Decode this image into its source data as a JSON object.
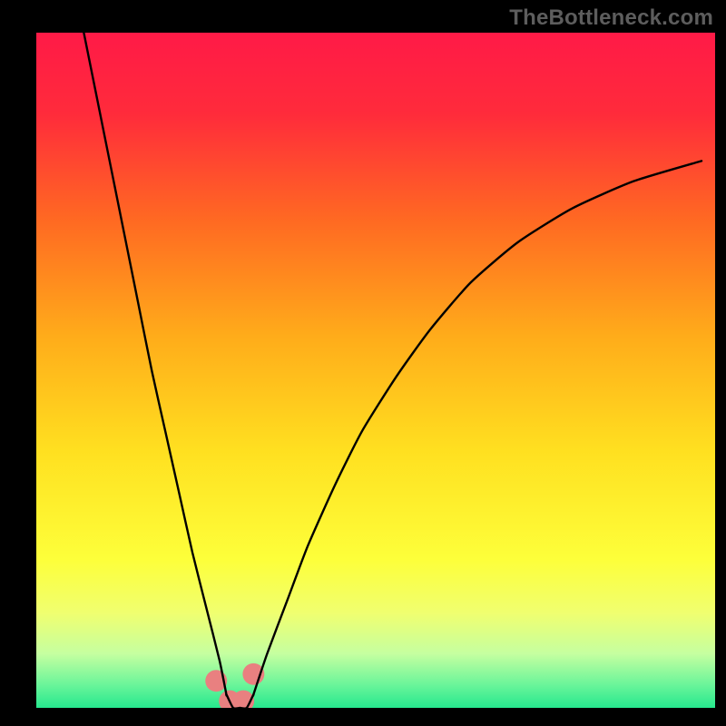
{
  "watermark": "TheBottleneck.com",
  "colors": {
    "frame_black": "#000000",
    "curve_stroke": "#000000",
    "bump_fill": "#e98080",
    "gradient_stops": [
      {
        "offset": 0.0,
        "color": "#ff1a47"
      },
      {
        "offset": 0.12,
        "color": "#ff2b3b"
      },
      {
        "offset": 0.28,
        "color": "#ff6a22"
      },
      {
        "offset": 0.45,
        "color": "#ffac1a"
      },
      {
        "offset": 0.62,
        "color": "#ffe020"
      },
      {
        "offset": 0.78,
        "color": "#fdff3a"
      },
      {
        "offset": 0.86,
        "color": "#f0ff70"
      },
      {
        "offset": 0.92,
        "color": "#c5ffa0"
      },
      {
        "offset": 0.965,
        "color": "#6cf59a"
      },
      {
        "offset": 1.0,
        "color": "#26e88e"
      }
    ]
  },
  "chart_data": {
    "type": "line",
    "title": "",
    "xlabel": "",
    "ylabel": "",
    "xlim": [
      0,
      100
    ],
    "ylim": [
      0,
      100
    ],
    "note": "x and y are percentages of the inner plot area (origin bottom-left). The curve is a V-shaped bottleneck profile: both branches fall steeply toward a minimum around x≈28–32 where they touch the green band (y≈0), then the right branch rises with diminishing slope toward the upper-right. Values are read off the rendered pixels to ~1% precision.",
    "series": [
      {
        "name": "left_branch",
        "x": [
          7,
          9,
          11,
          13,
          15,
          17,
          19,
          21,
          23,
          25,
          27,
          28
        ],
        "y": [
          100,
          90,
          80,
          70,
          60,
          50,
          41,
          32,
          23,
          15,
          7,
          2
        ]
      },
      {
        "name": "floor_segment",
        "x": [
          28,
          29,
          30,
          31,
          32
        ],
        "y": [
          2,
          0,
          0,
          0,
          2
        ]
      },
      {
        "name": "right_branch",
        "x": [
          32,
          34,
          37,
          40,
          44,
          48,
          53,
          58,
          64,
          71,
          79,
          88,
          98
        ],
        "y": [
          2,
          8,
          16,
          24,
          33,
          41,
          49,
          56,
          63,
          69,
          74,
          78,
          81
        ]
      }
    ],
    "markers": {
      "name": "salmon_bumps_near_minimum",
      "x": [
        26.5,
        28.5,
        30.5,
        32.0
      ],
      "y": [
        4.0,
        1.0,
        1.0,
        5.0
      ],
      "r_pct": 1.6
    }
  }
}
